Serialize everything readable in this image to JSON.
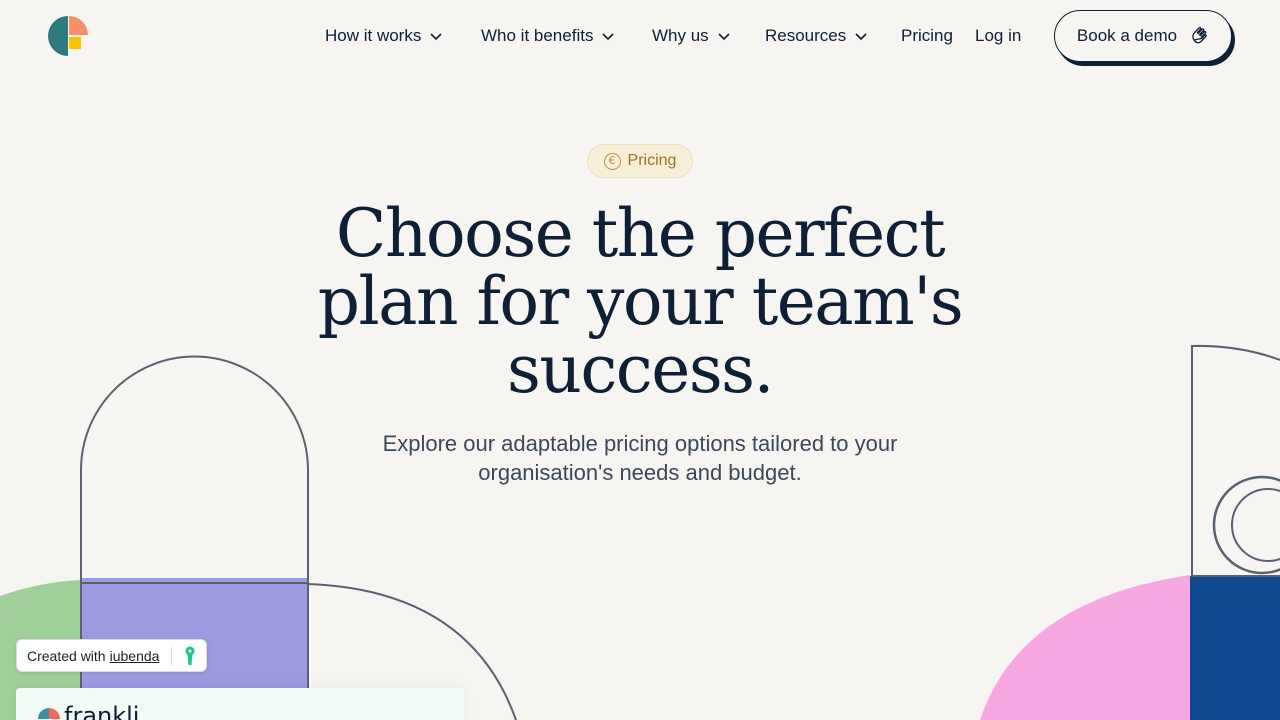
{
  "brand": {
    "name": "frankli"
  },
  "nav": {
    "items": [
      {
        "label": "How it works",
        "has_dropdown": true
      },
      {
        "label": "Who it benefits",
        "has_dropdown": true
      },
      {
        "label": "Why us",
        "has_dropdown": true
      },
      {
        "label": "Resources",
        "has_dropdown": true
      },
      {
        "label": "Pricing",
        "has_dropdown": false
      },
      {
        "label": "Log in",
        "has_dropdown": false
      }
    ],
    "cta": {
      "label": "Book a demo",
      "icon": "waving-hand-icon"
    }
  },
  "hero": {
    "badge": {
      "label": "Pricing",
      "icon": "euro-icon"
    },
    "title": "Choose the perfect plan for your team's success.",
    "subtitle": "Explore our adaptable pricing options tailored to your organisation's needs and budget."
  },
  "cookie_badge": {
    "prefix": "Created with",
    "link": "iubenda"
  },
  "colors": {
    "background": "#f6f5f2",
    "text": "#0f1f35",
    "badge_bg": "#f6eed6",
    "badge_text": "#9a7425",
    "purple": "#9e9ae2",
    "green": "#9fd09a",
    "pink": "#f7a8e3",
    "navy": "#0f4a8e"
  }
}
